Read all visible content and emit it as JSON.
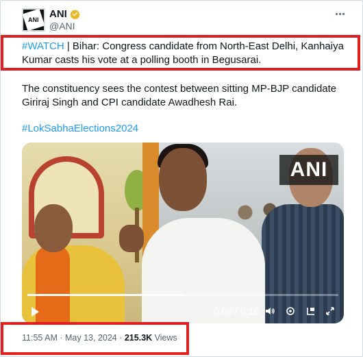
{
  "author": {
    "display_name": "ANI",
    "handle": "@ANI",
    "avatar_text": "ANI"
  },
  "tweet": {
    "hashtag_watch": "#WATCH",
    "line1_rest": " | Bihar: Congress candidate from North-East Delhi, Kanhaiya Kumar casts his vote at a polling booth in Begusarai.",
    "paragraph2": "The constituency sees the contest between sitting MP-BJP candidate Giriraj Singh and CPI candidate Awadhesh Rai.",
    "hashtag_election": "#LokSabhaElections2024"
  },
  "video": {
    "watermark": "ANI",
    "time": "0:08 / 0:16",
    "progress": 0.5
  },
  "meta": {
    "time": "11:55 AM",
    "sep1": " · ",
    "date": "May 13, 2024",
    "sep2": " · ",
    "views_count": "215.3K",
    "views_label": " Views"
  },
  "colors": {
    "link": "#1d9bf0",
    "highlight_border": "#e02020",
    "verified": "#e8b829"
  },
  "icons": [
    "verified-badge-icon",
    "more-icon",
    "play-icon",
    "volume-icon",
    "settings-icon",
    "pip-icon",
    "fullscreen-icon"
  ]
}
